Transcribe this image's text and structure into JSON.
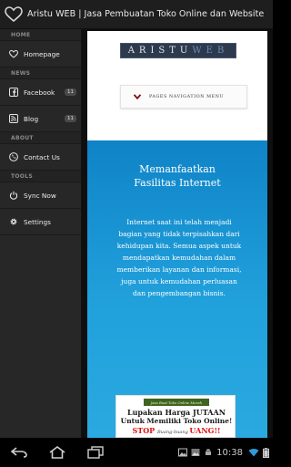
{
  "window": {
    "title": "Aristu WEB | Jasa Pembuatan Toko Online dan Website",
    "app_icon": "heart-outline-icon"
  },
  "drawer": {
    "sections": [
      {
        "header": "HOME",
        "items": [
          {
            "label": "Homepage",
            "icon": "heart-outline-icon"
          }
        ]
      },
      {
        "header": "NEWS",
        "items": [
          {
            "label": "Facebook",
            "icon": "facebook-icon",
            "count": "11"
          },
          {
            "label": "Blog",
            "icon": "rss-icon",
            "count": "11"
          }
        ]
      },
      {
        "header": "ABOUT",
        "items": [
          {
            "label": "Contact Us",
            "icon": "phone-icon"
          }
        ]
      },
      {
        "header": "TOOLS",
        "items": [
          {
            "label": "Sync Now",
            "icon": "power-icon"
          },
          {
            "label": "Settings",
            "icon": "gear-icon"
          }
        ]
      }
    ]
  },
  "main": {
    "logo": {
      "part_a": "ARISTU",
      "part_b": "WEB"
    },
    "nav_button": "PAGES NAVIGATION MENU",
    "heading_line1": "Memanfaatkan",
    "heading_line2": "Fasilitas Internet",
    "paragraph": "Internet saat ini telah menjadi bagian yang tidak terpisahkan dari kehidupan kita. Semua aspek untuk mendapatkan kemudahan dalam memberikan layanan dan informasi, juga untuk kemudahan perluasan dan pengembangan bisnis.",
    "banner": {
      "tag": "Jasa Buat Toko Online Murah",
      "line1": "Lupakan Harga JUTAAN",
      "line2": "Untuk Memiliki Toko Online!",
      "line3_a": "STOP ",
      "line3_b": "Buang-buang ",
      "line3_c": "UANG!!"
    }
  },
  "system_bar": {
    "time": "10:38",
    "colors": {
      "bar": "#000000",
      "accent_blue": "#21a1dc"
    }
  }
}
